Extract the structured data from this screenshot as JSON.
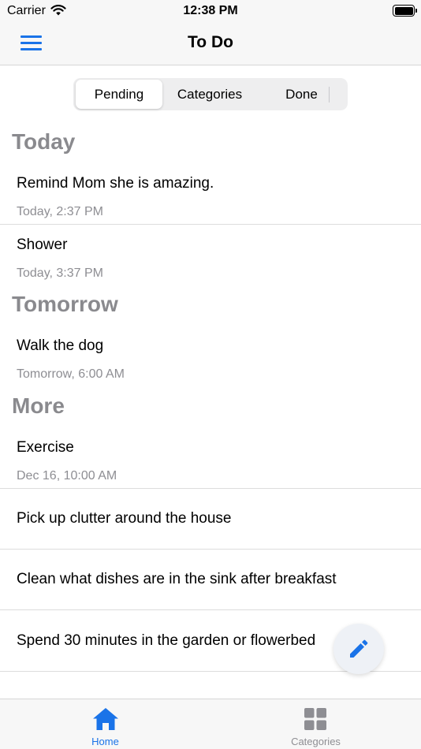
{
  "status_bar": {
    "carrier": "Carrier",
    "time": "12:38 PM"
  },
  "nav": {
    "title": "To Do"
  },
  "segments": [
    {
      "label": "Pending",
      "selected": true
    },
    {
      "label": "Categories",
      "selected": false
    },
    {
      "label": "Done",
      "selected": false
    }
  ],
  "sections": [
    {
      "header": "Today",
      "items": [
        {
          "title": "Remind Mom she is amazing.",
          "subtitle": "Today, 2:37 PM"
        },
        {
          "title": "Shower",
          "subtitle": "Today, 3:37 PM"
        }
      ]
    },
    {
      "header": "Tomorrow",
      "items": [
        {
          "title": "Walk the dog",
          "subtitle": "Tomorrow, 6:00 AM"
        }
      ]
    },
    {
      "header": "More",
      "items": [
        {
          "title": "Exercise",
          "subtitle": "Dec 16, 10:00 AM"
        },
        {
          "title": "Pick up clutter around the house"
        },
        {
          "title": "Clean what dishes are in the sink after breakfast"
        },
        {
          "title": "Spend 30 minutes in the garden or flowerbed"
        }
      ]
    }
  ],
  "fab": {
    "icon": "pencil-icon"
  },
  "tabs": [
    {
      "label": "Home",
      "icon": "home-icon",
      "active": true
    },
    {
      "label": "Categories",
      "icon": "grid-icon",
      "active": false
    }
  ],
  "colors": {
    "accent": "#1a73e8",
    "section_header": "#8a8a8e",
    "subtitle": "#8e8e93",
    "tab_inactive": "#8e8e93"
  }
}
